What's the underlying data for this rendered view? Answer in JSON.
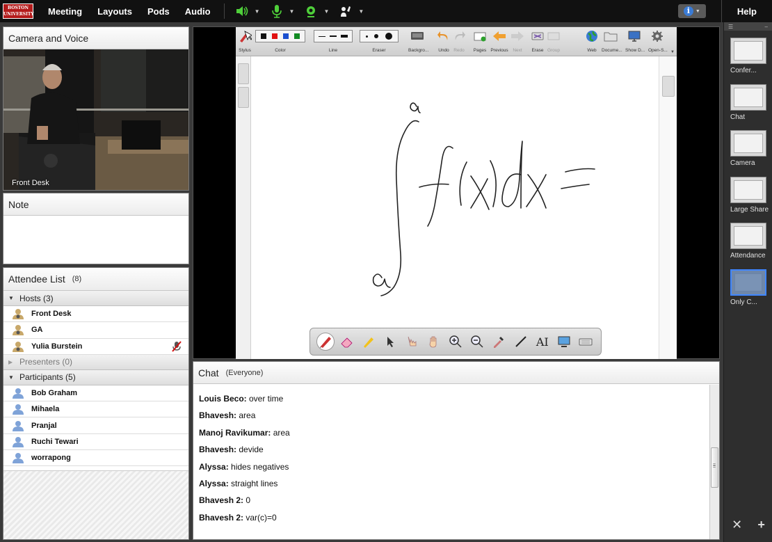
{
  "menubar": {
    "logo_line1": "BOSTON",
    "logo_line2": "UNIVERSITY",
    "items": [
      "Meeting",
      "Layouts",
      "Pods",
      "Audio"
    ],
    "help": "Help"
  },
  "camera_pod": {
    "title": "Camera and Voice",
    "caption": "Front Desk"
  },
  "note_pod": {
    "title": "Note"
  },
  "attendee_pod": {
    "title": "Attendee List",
    "count": "(8)",
    "hosts_label": "Hosts (3)",
    "hosts": [
      "Front Desk",
      "GA",
      "Yulia  Burstein"
    ],
    "presenters_label": "Presenters (0)",
    "participants_label": "Participants (5)",
    "participants": [
      "Bob Graham",
      "Mihaela",
      "Pranjal",
      "Ruchi Tewari",
      "worrapong"
    ]
  },
  "whiteboard": {
    "toolbar": {
      "stylus": "Stylus",
      "color": "Color",
      "line": "Line",
      "eraser": "Eraser",
      "background": "Backgro...",
      "undo": "Undo",
      "redo": "Redo",
      "pages": "Pages",
      "previous": "Previous",
      "next": "Next",
      "erase": "Erase",
      "group": "Group",
      "web": "Web",
      "document": "Docume...",
      "show_d": "Show D...",
      "open_s": "Open-S..."
    },
    "palette": [
      "#111111",
      "#e01010",
      "#1a4fcf",
      "#118a22"
    ]
  },
  "chat_pod": {
    "title": "Chat",
    "scope": "(Everyone)",
    "messages": [
      {
        "user": "Louis Beco:",
        "text": " over time"
      },
      {
        "user": "Bhavesh:",
        "text": " area"
      },
      {
        "user": "Manoj Ravikumar:",
        "text": " area"
      },
      {
        "user": "Bhavesh:",
        "text": " devide"
      },
      {
        "user": "Alyssa:",
        "text": " hides negatives"
      },
      {
        "user": "Alyssa:",
        "text": " straight lines"
      },
      {
        "user": "Bhavesh 2:",
        "text": " 0"
      },
      {
        "user": "Bhavesh 2:",
        "text": " var(c)=0"
      }
    ]
  },
  "layouts": [
    {
      "name": "Confer...",
      "selected": false
    },
    {
      "name": "Chat",
      "selected": false
    },
    {
      "name": "Camera",
      "selected": false
    },
    {
      "name": "Large Share",
      "selected": false
    },
    {
      "name": "Attendance",
      "selected": false
    },
    {
      "name": "Only C...",
      "selected": true
    }
  ],
  "layout_footer": {
    "close": "✕",
    "add": "+"
  }
}
